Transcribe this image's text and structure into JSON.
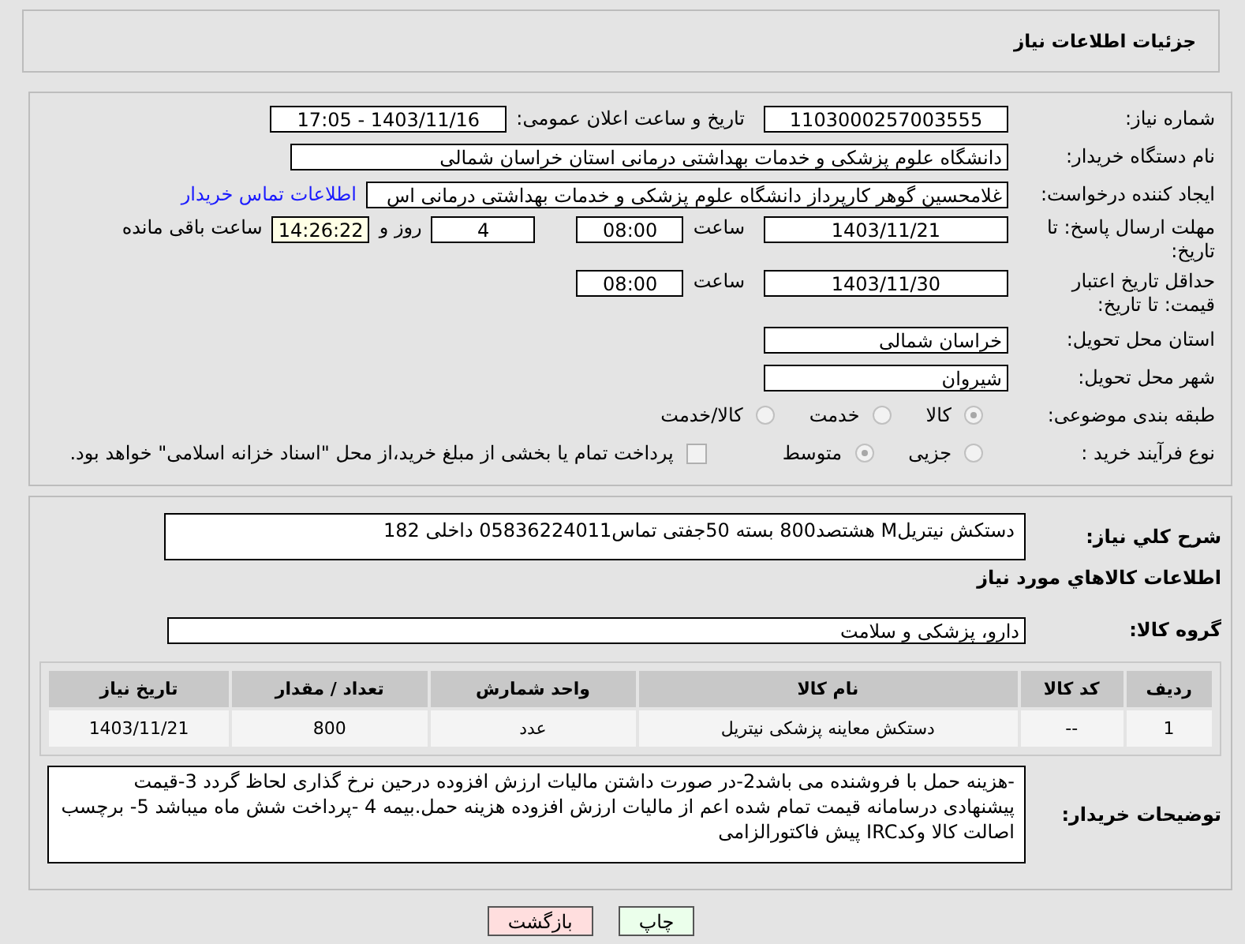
{
  "header": {
    "title": "جزئیات اطلاعات نیاز"
  },
  "need_number": {
    "label": "شماره نیاز:",
    "value": "1103000257003555"
  },
  "announcement": {
    "label": "تاریخ و ساعت اعلان عمومی:",
    "value": "1403/11/16 - 17:05"
  },
  "buyer_org": {
    "label": "نام دستگاه خریدار:",
    "value": "دانشگاه علوم پزشکی و خدمات بهداشتی درمانی استان خراسان شمالی"
  },
  "requester": {
    "label": "ایجاد کننده درخواست:",
    "value": "غلامحسین گوهر کارپرداز  دانشگاه علوم پزشکی و خدمات بهداشتی درمانی اس",
    "link": "اطلاعات تماس خریدار"
  },
  "reply_deadline": {
    "label": "مهلت ارسال پاسخ: تا تاریخ:",
    "date": "1403/11/21",
    "time_label": "ساعت",
    "time": "08:00",
    "days": "4",
    "days_label": "روز و",
    "remaining": "14:26:22",
    "remaining_label": "ساعت باقی مانده"
  },
  "price_validity": {
    "label": "حداقل تاریخ اعتبار قیمت: تا تاریخ:",
    "date": "1403/11/30",
    "time_label": "ساعت",
    "time": "08:00"
  },
  "province": {
    "label": "استان محل تحویل:",
    "value": "خراسان شمالی"
  },
  "city": {
    "label": "شهر محل تحویل:",
    "value": "شیروان"
  },
  "category": {
    "label": "طبقه بندی موضوعی:",
    "options": [
      {
        "label": "کالا",
        "selected": true
      },
      {
        "label": "خدمت",
        "selected": false
      },
      {
        "label": "کالا/خدمت",
        "selected": false
      }
    ]
  },
  "purchase_process": {
    "label": "نوع فرآیند خرید :",
    "options": [
      {
        "label": "جزیی",
        "selected": false
      },
      {
        "label": "متوسط",
        "selected": true
      }
    ],
    "treasury": {
      "label": "پرداخت تمام یا بخشی از مبلغ خرید،از محل \"اسناد خزانه اسلامی\" خواهد بود.",
      "checked": false
    }
  },
  "description": {
    "label": "شرح کلي نياز:",
    "value": "دستکش نیتریلM هشتصد800 بسته 50جفتی تماس05836224011 داخلی 182"
  },
  "goods_title": "اطلاعات کالاهاي مورد نياز",
  "goods_group": {
    "label": "گروه کالا:",
    "value": "دارو، پزشکی و سلامت"
  },
  "table": {
    "columns": [
      "ردیف",
      "کد کالا",
      "نام کالا",
      "واحد شمارش",
      "تعداد / مقدار",
      "تاریخ نیاز"
    ],
    "rows": [
      [
        "1",
        "--",
        "دستکش معاینه پزشکی نیتریل",
        "عدد",
        "800",
        "1403/11/21"
      ]
    ]
  },
  "buyer_notes": {
    "label": "توضیحات خریدار:",
    "value": "-هزینه حمل با فروشنده می باشد2-در صورت داشتن مالیات ارزش افزوده درحین نرخ گذاری لحاظ گردد 3-قیمت پیشنهادی درسامانه  قیمت تمام شده اعم از مالیات ارزش افزوده هزینه حمل.بیمه  4 -پرداخت شش ماه میباشد 5- برچسب اصالت کالا وکدIRC پیش فاکتورالزامی"
  },
  "buttons": [
    {
      "label": "چاپ",
      "kind": "print"
    },
    {
      "label": "بازگشت",
      "kind": "back"
    }
  ]
}
